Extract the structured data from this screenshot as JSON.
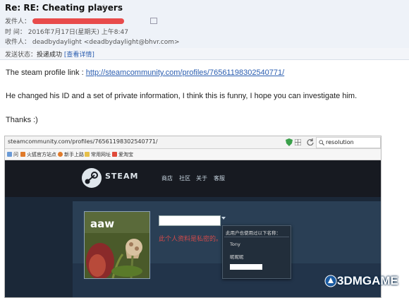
{
  "email": {
    "subject": "Re: RE: Cheating players",
    "star_icon": "star-outline-icon",
    "from_label": "发件人：",
    "time_label": "时 间：",
    "time_value": "2016年7月17日(星期天) 上午8:47",
    "to_label": "收件人：",
    "to_value": "deadbydaylight <deadbydaylight@bhvr.com>",
    "status_label": "发送状态：",
    "status_value": "投递成功",
    "status_link": "[查看详情]"
  },
  "body": {
    "link_prefix": "The steam profile link : ",
    "link_url": "http://steamcommunity.com/profiles/76561198302540771/",
    "message": "He changed his ID and a set of private information, I think this is funny, I hope you can investigate him.",
    "thanks": "Thanks   :)"
  },
  "browser": {
    "url": "steamcommunity.com/profiles/76561198302540771/",
    "search_value": "resolution",
    "bookmarks": [
      {
        "label": "问",
        "color": "#6a9ad6"
      },
      {
        "label": "火狐官方站点",
        "color": "#e07a2a"
      },
      {
        "label": "新手上路",
        "color": "#e07a2a"
      },
      {
        "label": "常用网址",
        "color": "#e6c04a"
      },
      {
        "label": "爱淘宝",
        "color": "#e04a3a"
      }
    ]
  },
  "steam": {
    "logo_text": "STEAM",
    "nav": [
      "商店",
      "社区",
      "关于",
      "客服"
    ],
    "avatar_text": "aaw",
    "private_text": "此个人资料是私密的。",
    "popup_title": "此用户也使用过以下名称：",
    "popup_names": [
      "Tony",
      "昵昵昵"
    ]
  },
  "watermark": "3DMGAME"
}
